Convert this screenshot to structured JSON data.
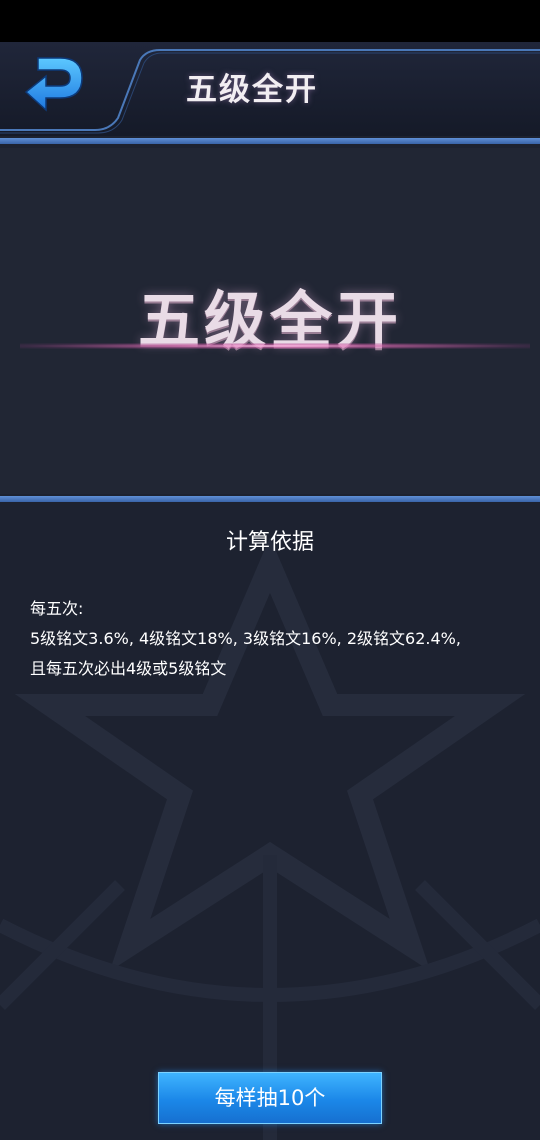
{
  "header": {
    "title": "五级全开",
    "back_icon": "back-arrow-icon"
  },
  "banner": {
    "title": "五级全开"
  },
  "basis": {
    "title": "计算依据",
    "lines": [
      "每五次:",
      "5级铭文3.6%, 4级铭文18%, 3级铭文16%, 2级铭文62.4%,",
      "且每五次必出4级或5级铭文"
    ]
  },
  "action": {
    "draw_label": "每样抽10个"
  },
  "colors": {
    "accent_blue": "#3a64a8",
    "button_blue": "#1b87e8",
    "background": "#1d2230",
    "banner_glow": "#e8a0d0"
  }
}
